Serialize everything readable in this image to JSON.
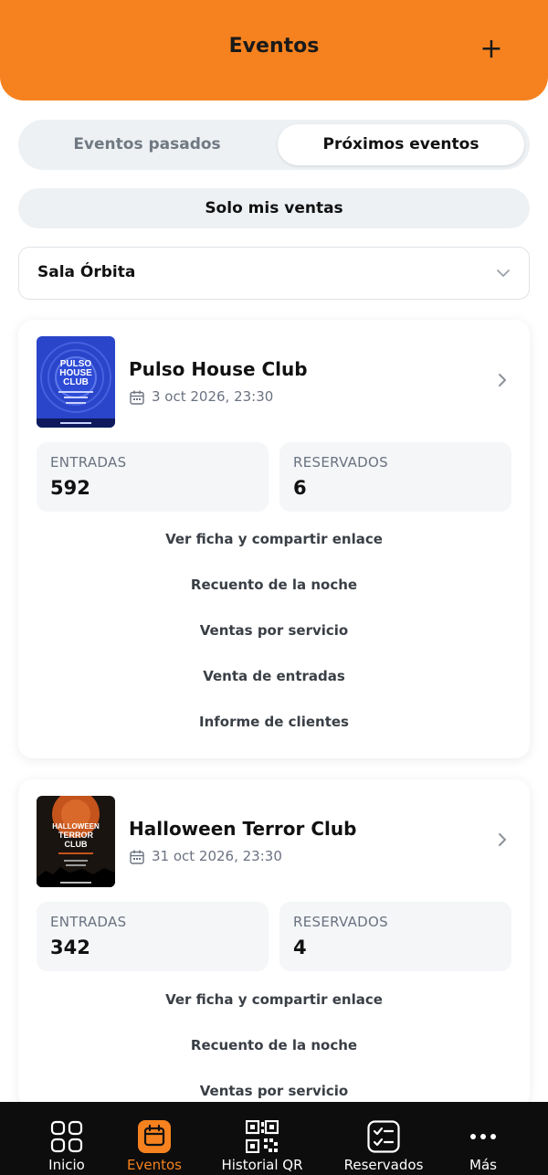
{
  "header": {
    "title": "Eventos",
    "add_label": "+"
  },
  "segmented": {
    "past_label": "Eventos pasados",
    "upcoming_label": "Próximos eventos",
    "selected": "upcoming"
  },
  "filter": {
    "my_sales_label": "Solo mis ventas"
  },
  "venue_select": {
    "value": "Sala Órbita"
  },
  "events": [
    {
      "title": "Pulso House Club",
      "date": "3 oct 2026, 23:30",
      "poster_text": [
        "PULSO",
        "HOUSE",
        "CLUB"
      ],
      "stats": [
        {
          "label": "ENTRADAS",
          "value": "592"
        },
        {
          "label": "RESERVADOS",
          "value": "6"
        }
      ],
      "actions": [
        "Ver ficha y compartir enlace",
        "Recuento de la noche",
        "Ventas por servicio",
        "Venta de entradas",
        "Informe de clientes"
      ]
    },
    {
      "title": "Halloween Terror Club",
      "date": "31 oct 2026, 23:30",
      "poster_text": [
        "HALLOWEEN",
        "TERROR",
        "CLUB"
      ],
      "stats": [
        {
          "label": "ENTRADAS",
          "value": "342"
        },
        {
          "label": "RESERVADOS",
          "value": "4"
        }
      ],
      "actions": [
        "Ver ficha y compartir enlace",
        "Recuento de la noche",
        "Ventas por servicio"
      ]
    }
  ],
  "tabbar": {
    "items": [
      {
        "label": "Inicio",
        "icon": "grid-icon"
      },
      {
        "label": "Eventos",
        "icon": "calendar-icon",
        "active": true
      },
      {
        "label": "Historial QR",
        "icon": "qr-code-icon"
      },
      {
        "label": "Reservados",
        "icon": "checklist-icon"
      },
      {
        "label": "Más",
        "icon": "more-dots-icon"
      }
    ]
  },
  "colors": {
    "accent": "#f5821f",
    "tabbar_bg": "#0d0d0d",
    "muted_text": "#6b7280"
  }
}
